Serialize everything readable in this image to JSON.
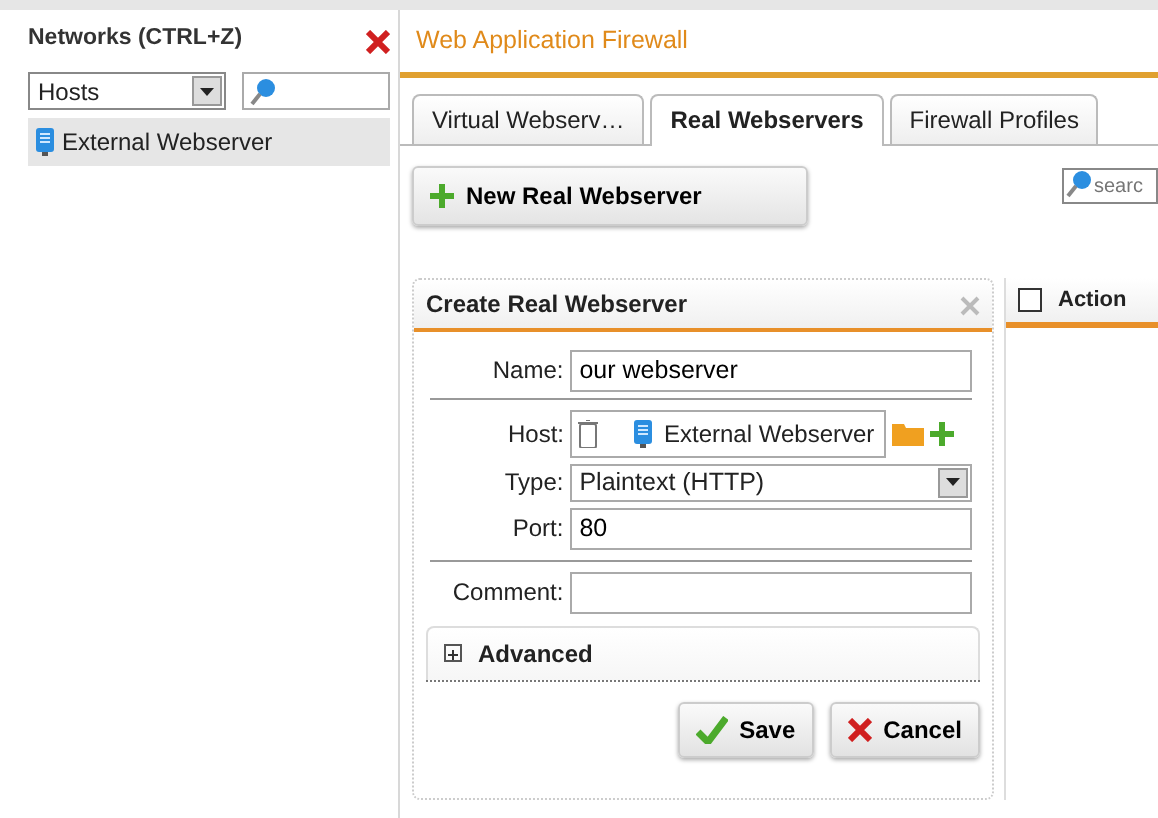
{
  "sidebar": {
    "title": "Networks (CTRL+Z)",
    "filter": "Hosts",
    "items": [
      {
        "label": "External Webserver",
        "selected": true
      }
    ]
  },
  "main": {
    "title": "Web Application Firewall",
    "tabs": [
      {
        "label": "Virtual Webserv…",
        "selected": false
      },
      {
        "label": "Real Webservers",
        "selected": true
      },
      {
        "label": "Firewall Profiles",
        "selected": false
      }
    ],
    "new_button": "New Real Webserver",
    "search": {
      "placeholder": "searc"
    },
    "dialog": {
      "title": "Create Real Webserver",
      "fields": [
        {
          "kind": "text",
          "label": "Name:",
          "value": "our webserver"
        },
        {
          "kind": "host",
          "label": "Host:",
          "value": "External Webserver"
        },
        {
          "kind": "select",
          "label": "Type:",
          "value": "Plaintext (HTTP)"
        },
        {
          "kind": "text",
          "label": "Port:",
          "value": "80"
        },
        {
          "kind": "text",
          "label": "Comment:"
        }
      ],
      "advanced": {
        "label": "Advanced",
        "expanded": false
      },
      "buttons": [
        {
          "kind": "save",
          "label": "Save"
        },
        {
          "kind": "cancel",
          "label": "Cancel"
        }
      ]
    },
    "table": {
      "columns": [
        "Action"
      ],
      "select_all_checked": false
    }
  }
}
